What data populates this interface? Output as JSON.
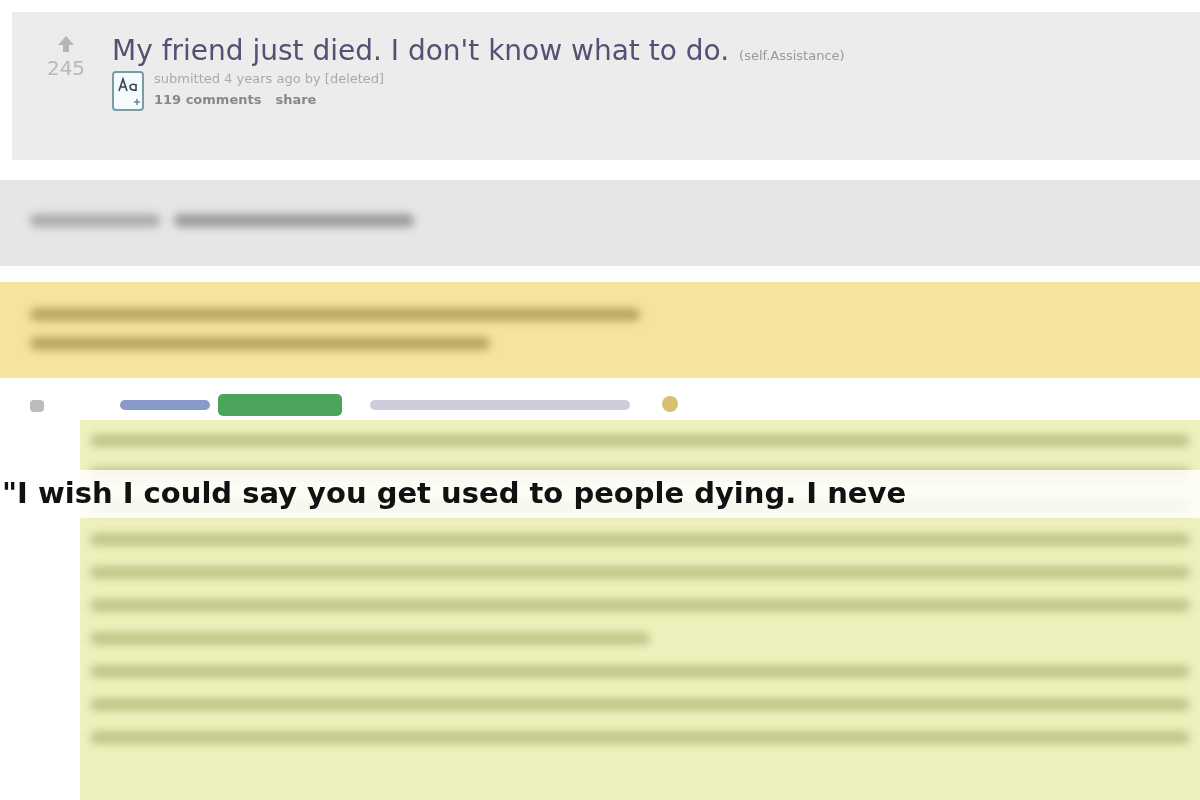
{
  "post": {
    "score": "245",
    "title": "My friend just died. I don't know what to do.",
    "domain": "(self.Assistance)",
    "meta": "submitted 4 years ago by [deleted]",
    "links": [
      "119 comments",
      "share"
    ]
  },
  "caption": "\"I wish I could say you get used to people dying. I neve"
}
